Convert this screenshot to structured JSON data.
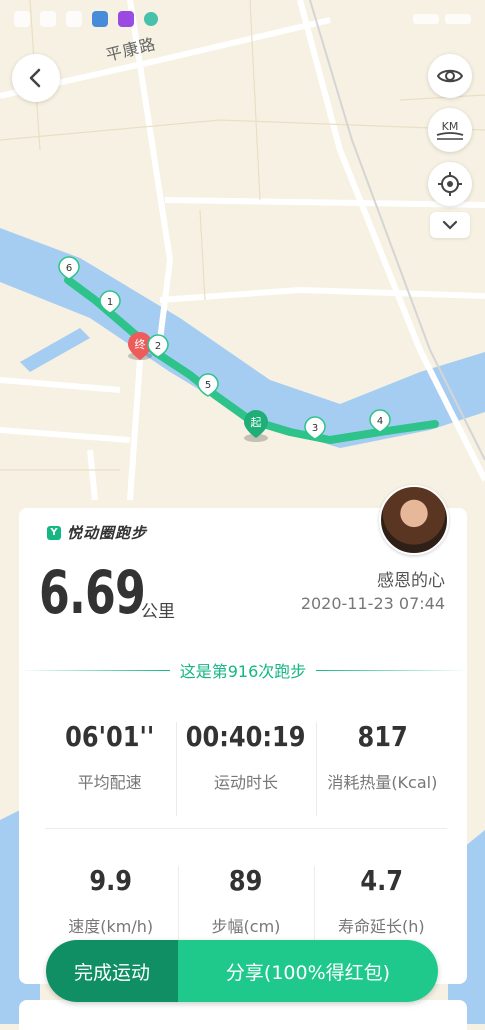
{
  "map": {
    "road_label": "平康路",
    "start_marker": "起",
    "end_marker": "终",
    "km_markers": [
      "1",
      "2",
      "3",
      "4",
      "5",
      "6"
    ],
    "icons": [
      "back-icon",
      "eye-icon",
      "km-icon",
      "locate-icon",
      "chevron-down-icon"
    ],
    "colors": {
      "route": "#2ec38a",
      "water": "#a5cdf2",
      "end_marker": "#ee5b5b"
    }
  },
  "km_button": {
    "label": "KM"
  },
  "card": {
    "brand": "悦动圈跑步",
    "distance": "6.69",
    "unit": "公里",
    "username": "感恩的心",
    "datetime": "2020-11-23 07:44",
    "run_count_text": "这是第916次跑步",
    "stats_row1": [
      {
        "value": "06'01''",
        "label": "平均配速"
      },
      {
        "value": "00:40:19",
        "label": "运动时长"
      },
      {
        "value": "817",
        "label": "消耗热量(Kcal)"
      }
    ],
    "stats_row2": [
      {
        "value": "9.9",
        "label": "速度(km/h)"
      },
      {
        "value": "89",
        "label": "步幅(cm)"
      },
      {
        "value": "4.7",
        "label": "寿命延长(h)"
      }
    ]
  },
  "actions": {
    "finish_label": "完成运动",
    "share_label": "分享(100%得红包)"
  }
}
